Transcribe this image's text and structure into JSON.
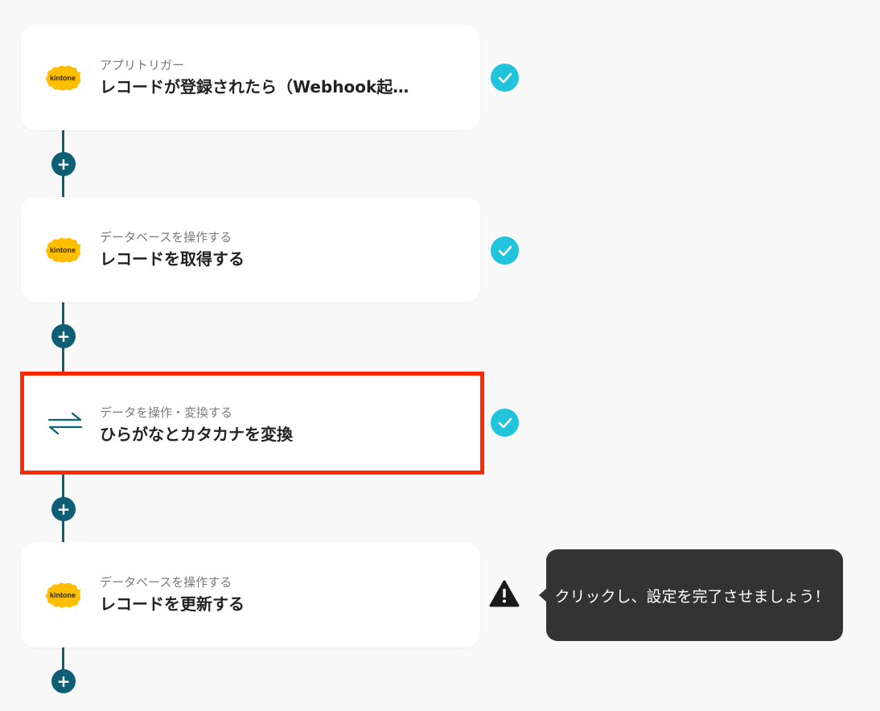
{
  "steps": [
    {
      "sublabel": "アプリトリガー",
      "title": "レコードが登録されたら（Webhook起…",
      "app_icon": "kintone-logo-icon",
      "logo_text": "kintone",
      "status": "complete"
    },
    {
      "sublabel": "データベースを操作する",
      "title": "レコードを取得する",
      "app_icon": "kintone-logo-icon",
      "logo_text": "kintone",
      "status": "complete"
    },
    {
      "sublabel": "データを操作・変換する",
      "title": "ひらがなとカタカナを変換",
      "app_icon": "swap-arrows-icon",
      "status": "complete",
      "highlighted": true
    },
    {
      "sublabel": "データベースを操作する",
      "title": "レコードを更新する",
      "app_icon": "kintone-logo-icon",
      "logo_text": "kintone",
      "status": "warning"
    }
  ],
  "add_step_symbol": "+",
  "tooltip": {
    "text": "クリックし、設定を完了させましょう！"
  },
  "colors": {
    "connector": "#0e5f76",
    "check": "#22c4dc",
    "highlight_border": "#ff2a00",
    "kintone_yellow": "#ffbe00",
    "tooltip_bg": "#333333"
  }
}
